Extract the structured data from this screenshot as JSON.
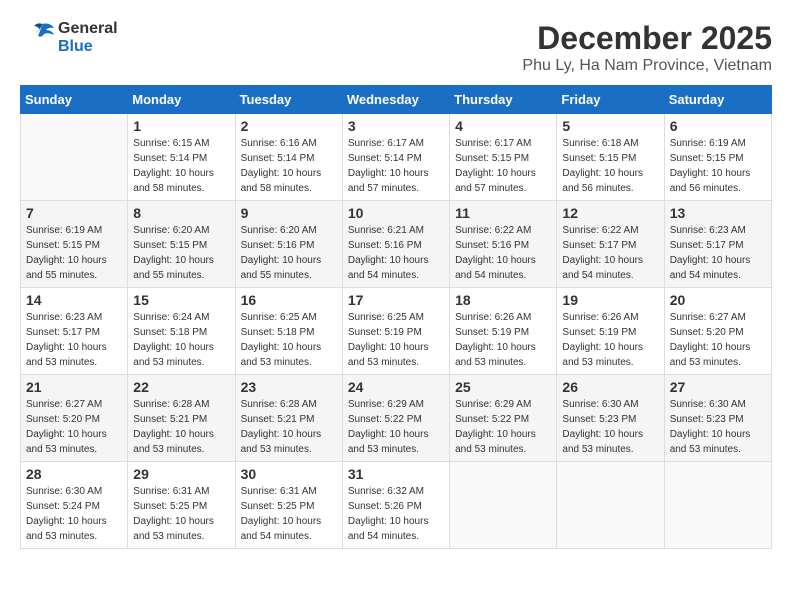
{
  "logo": {
    "line1": "General",
    "line2": "Blue"
  },
  "title": "December 2025",
  "location": "Phu Ly, Ha Nam Province, Vietnam",
  "days_of_week": [
    "Sunday",
    "Monday",
    "Tuesday",
    "Wednesday",
    "Thursday",
    "Friday",
    "Saturday"
  ],
  "weeks": [
    [
      {
        "day": "",
        "info": ""
      },
      {
        "day": "1",
        "info": "Sunrise: 6:15 AM\nSunset: 5:14 PM\nDaylight: 10 hours\nand 58 minutes."
      },
      {
        "day": "2",
        "info": "Sunrise: 6:16 AM\nSunset: 5:14 PM\nDaylight: 10 hours\nand 58 minutes."
      },
      {
        "day": "3",
        "info": "Sunrise: 6:17 AM\nSunset: 5:14 PM\nDaylight: 10 hours\nand 57 minutes."
      },
      {
        "day": "4",
        "info": "Sunrise: 6:17 AM\nSunset: 5:15 PM\nDaylight: 10 hours\nand 57 minutes."
      },
      {
        "day": "5",
        "info": "Sunrise: 6:18 AM\nSunset: 5:15 PM\nDaylight: 10 hours\nand 56 minutes."
      },
      {
        "day": "6",
        "info": "Sunrise: 6:19 AM\nSunset: 5:15 PM\nDaylight: 10 hours\nand 56 minutes."
      }
    ],
    [
      {
        "day": "7",
        "info": "Sunrise: 6:19 AM\nSunset: 5:15 PM\nDaylight: 10 hours\nand 55 minutes."
      },
      {
        "day": "8",
        "info": "Sunrise: 6:20 AM\nSunset: 5:15 PM\nDaylight: 10 hours\nand 55 minutes."
      },
      {
        "day": "9",
        "info": "Sunrise: 6:20 AM\nSunset: 5:16 PM\nDaylight: 10 hours\nand 55 minutes."
      },
      {
        "day": "10",
        "info": "Sunrise: 6:21 AM\nSunset: 5:16 PM\nDaylight: 10 hours\nand 54 minutes."
      },
      {
        "day": "11",
        "info": "Sunrise: 6:22 AM\nSunset: 5:16 PM\nDaylight: 10 hours\nand 54 minutes."
      },
      {
        "day": "12",
        "info": "Sunrise: 6:22 AM\nSunset: 5:17 PM\nDaylight: 10 hours\nand 54 minutes."
      },
      {
        "day": "13",
        "info": "Sunrise: 6:23 AM\nSunset: 5:17 PM\nDaylight: 10 hours\nand 54 minutes."
      }
    ],
    [
      {
        "day": "14",
        "info": "Sunrise: 6:23 AM\nSunset: 5:17 PM\nDaylight: 10 hours\nand 53 minutes."
      },
      {
        "day": "15",
        "info": "Sunrise: 6:24 AM\nSunset: 5:18 PM\nDaylight: 10 hours\nand 53 minutes."
      },
      {
        "day": "16",
        "info": "Sunrise: 6:25 AM\nSunset: 5:18 PM\nDaylight: 10 hours\nand 53 minutes."
      },
      {
        "day": "17",
        "info": "Sunrise: 6:25 AM\nSunset: 5:19 PM\nDaylight: 10 hours\nand 53 minutes."
      },
      {
        "day": "18",
        "info": "Sunrise: 6:26 AM\nSunset: 5:19 PM\nDaylight: 10 hours\nand 53 minutes."
      },
      {
        "day": "19",
        "info": "Sunrise: 6:26 AM\nSunset: 5:19 PM\nDaylight: 10 hours\nand 53 minutes."
      },
      {
        "day": "20",
        "info": "Sunrise: 6:27 AM\nSunset: 5:20 PM\nDaylight: 10 hours\nand 53 minutes."
      }
    ],
    [
      {
        "day": "21",
        "info": "Sunrise: 6:27 AM\nSunset: 5:20 PM\nDaylight: 10 hours\nand 53 minutes."
      },
      {
        "day": "22",
        "info": "Sunrise: 6:28 AM\nSunset: 5:21 PM\nDaylight: 10 hours\nand 53 minutes."
      },
      {
        "day": "23",
        "info": "Sunrise: 6:28 AM\nSunset: 5:21 PM\nDaylight: 10 hours\nand 53 minutes."
      },
      {
        "day": "24",
        "info": "Sunrise: 6:29 AM\nSunset: 5:22 PM\nDaylight: 10 hours\nand 53 minutes."
      },
      {
        "day": "25",
        "info": "Sunrise: 6:29 AM\nSunset: 5:22 PM\nDaylight: 10 hours\nand 53 minutes."
      },
      {
        "day": "26",
        "info": "Sunrise: 6:30 AM\nSunset: 5:23 PM\nDaylight: 10 hours\nand 53 minutes."
      },
      {
        "day": "27",
        "info": "Sunrise: 6:30 AM\nSunset: 5:23 PM\nDaylight: 10 hours\nand 53 minutes."
      }
    ],
    [
      {
        "day": "28",
        "info": "Sunrise: 6:30 AM\nSunset: 5:24 PM\nDaylight: 10 hours\nand 53 minutes."
      },
      {
        "day": "29",
        "info": "Sunrise: 6:31 AM\nSunset: 5:25 PM\nDaylight: 10 hours\nand 53 minutes."
      },
      {
        "day": "30",
        "info": "Sunrise: 6:31 AM\nSunset: 5:25 PM\nDaylight: 10 hours\nand 54 minutes."
      },
      {
        "day": "31",
        "info": "Sunrise: 6:32 AM\nSunset: 5:26 PM\nDaylight: 10 hours\nand 54 minutes."
      },
      {
        "day": "",
        "info": ""
      },
      {
        "day": "",
        "info": ""
      },
      {
        "day": "",
        "info": ""
      }
    ]
  ]
}
